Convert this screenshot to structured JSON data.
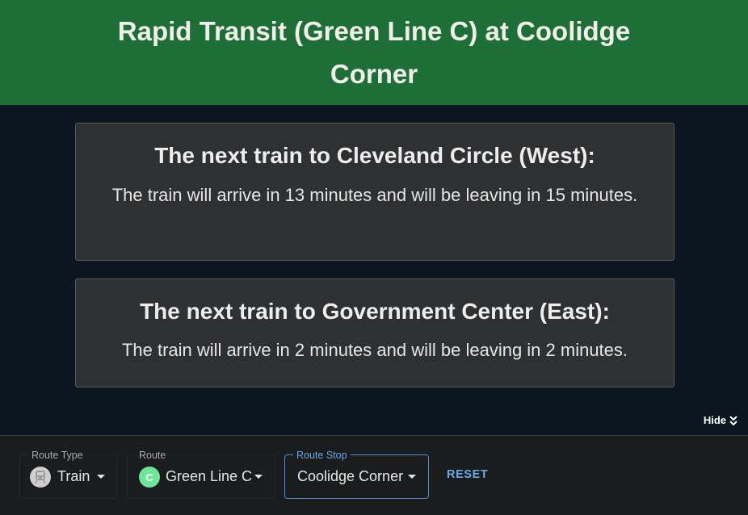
{
  "header": {
    "title": "Rapid Transit (Green Line C) at Coolidge Corner"
  },
  "predictions": [
    {
      "heading": "The next train to Cleveland Circle (West):",
      "message": "The train will arrive in 13 minutes and will be leaving in 15 minutes."
    },
    {
      "heading": "The next train to Government Center (East):",
      "message": "The train will arrive in 2 minutes and will be leaving in 2 minutes."
    }
  ],
  "toggle": {
    "label": "Hide",
    "icon": "double-chevron-down-icon"
  },
  "controls": {
    "route_type": {
      "label": "Route Type",
      "value": "Train",
      "icon": "train-icon"
    },
    "route": {
      "label": "Route",
      "value": "Green Line C",
      "avatar_letter": "C",
      "avatar_color": "#6ee59a"
    },
    "route_stop": {
      "label": "Route Stop",
      "value": "Coolidge Corner"
    },
    "reset_label": "RESET"
  },
  "colors": {
    "header_bg": "#1e6e37",
    "page_bg": "#0b1620",
    "card_bg": "#2f3032",
    "accent": "#6aa7e6"
  }
}
